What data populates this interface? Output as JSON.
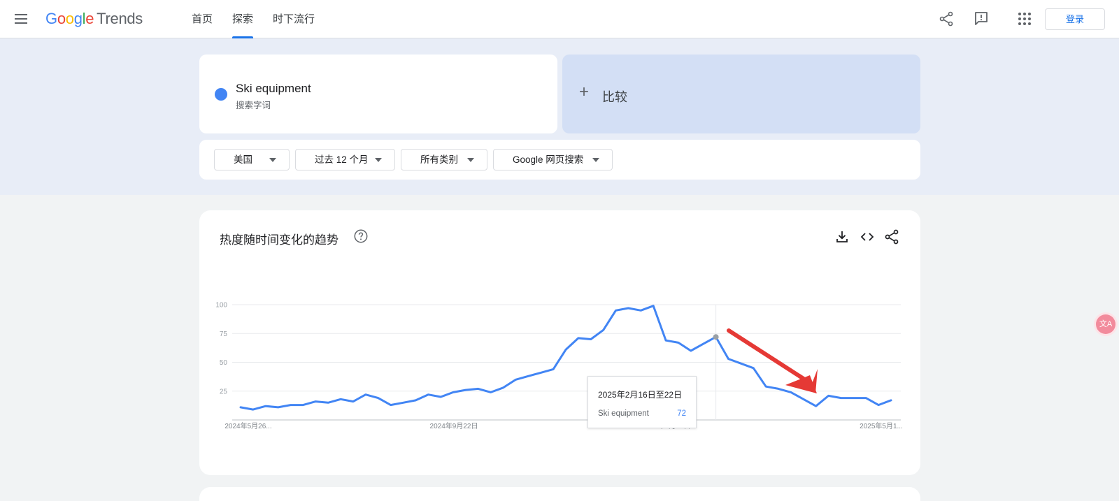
{
  "header": {
    "logo": {
      "g1": "G",
      "o1": "o",
      "o2": "o",
      "g2": "g",
      "l": "l",
      "e": "e",
      "suffix": "Trends"
    },
    "nav": [
      {
        "label": "首页"
      },
      {
        "label": "探索"
      },
      {
        "label": "时下流行"
      }
    ],
    "login_label": "登录"
  },
  "search_term": {
    "name": "Ski equipment",
    "type": "搜索字词",
    "color": "#4285f4"
  },
  "compare": {
    "plus": "+",
    "label": "比较"
  },
  "filters": [
    {
      "label": "美国"
    },
    {
      "label": "过去 12 个月"
    },
    {
      "label": "所有类别"
    },
    {
      "label": "Google 网页搜索"
    }
  ],
  "chart_card": {
    "title": "热度随时间变化的趋势"
  },
  "tooltip": {
    "date": "2025年2月16日至22日",
    "term": "Ski equipment",
    "value": "72"
  },
  "translate_fab": "文A",
  "chart_data": {
    "type": "line",
    "series": [
      {
        "name": "Ski equipment",
        "color": "#4285f4",
        "values": [
          11,
          9,
          12,
          11,
          13,
          13,
          16,
          15,
          18,
          16,
          22,
          19,
          13,
          15,
          17,
          22,
          20,
          24,
          26,
          27,
          24,
          28,
          35,
          38,
          41,
          44,
          61,
          71,
          70,
          78,
          95,
          97,
          95,
          99,
          69,
          67,
          60,
          66,
          72,
          53,
          49,
          45,
          29,
          27,
          24,
          18,
          12,
          21,
          19,
          19,
          19,
          13,
          17
        ]
      }
    ],
    "highlight_index": 38,
    "x_tick_labels": [
      "2024年5月26...",
      "2024年9月22日",
      "2025年1月19日",
      "2025年5月1..."
    ],
    "y_ticks": [
      25,
      50,
      75,
      100
    ],
    "ylim": [
      0,
      100
    ],
    "grid": true
  }
}
